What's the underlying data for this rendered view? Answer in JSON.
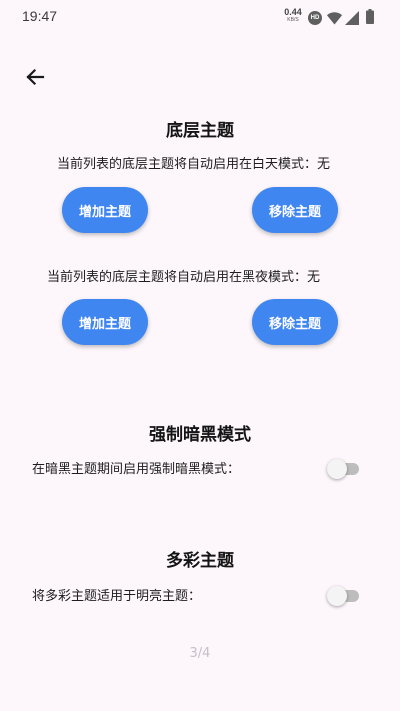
{
  "status_bar": {
    "time": "19:47",
    "net_speed_value": "0.44",
    "net_speed_unit": "KB/S",
    "hd_badge": "HD",
    "icons": [
      "hd-icon",
      "wifi-icon",
      "signal-icon",
      "battery-icon"
    ]
  },
  "nav": {
    "back_icon": "arrow-left-icon"
  },
  "base_theme": {
    "title": "底层主题",
    "day_mode_text": "当前列表的底层主题将自动启用在白天模式：无",
    "day_add_label": "增加主题",
    "day_remove_label": "移除主题",
    "night_mode_text": "当前列表的底层主题将自动启用在黑夜模式：无",
    "night_add_label": "增加主题",
    "night_remove_label": "移除主题"
  },
  "force_dark": {
    "title": "强制暗黑模式",
    "description": "在暗黑主题期间启用强制暗黑模式：",
    "enabled": false
  },
  "colorful_theme": {
    "title": "多彩主题",
    "description": "将多彩主题适用于明亮主题：",
    "enabled": false
  },
  "pager": {
    "label": "3/4"
  },
  "colors": {
    "accent": "#3f86f0",
    "background": "#fdf7fb",
    "switch_off_track": "#bdbdbd"
  }
}
